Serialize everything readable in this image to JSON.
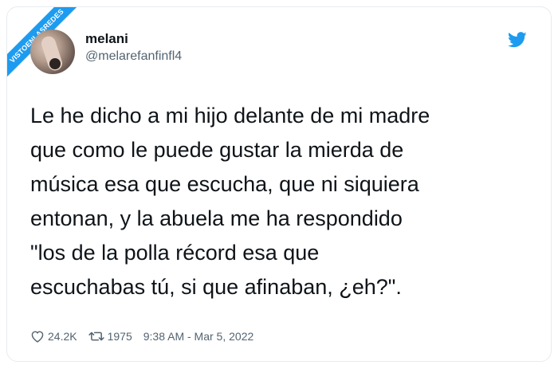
{
  "watermark": {
    "text": "VISTOENLASREDES"
  },
  "user": {
    "name": "melani",
    "handle": "@melarefanfinfl4"
  },
  "tweet": {
    "lines": [
      "Le he dicho a mi hijo delante de mi madre",
      "que como le puede gustar la mierda de",
      "música esa que escucha, que ni siquiera",
      "entonan, y la abuela me ha respondido",
      "\"los de la polla récord esa que",
      "escuchabas tú, si que afinaban, ¿eh?\"."
    ]
  },
  "stats": {
    "likes": "24.2K",
    "retweets": "1975",
    "timestamp": "9:38 AM - Mar 5, 2022"
  },
  "colors": {
    "brand": "#1d9bf0",
    "text": "#0f1419",
    "muted": "#536471"
  },
  "icons": [
    "twitter-bird-icon",
    "heart-icon",
    "retweet-icon"
  ]
}
